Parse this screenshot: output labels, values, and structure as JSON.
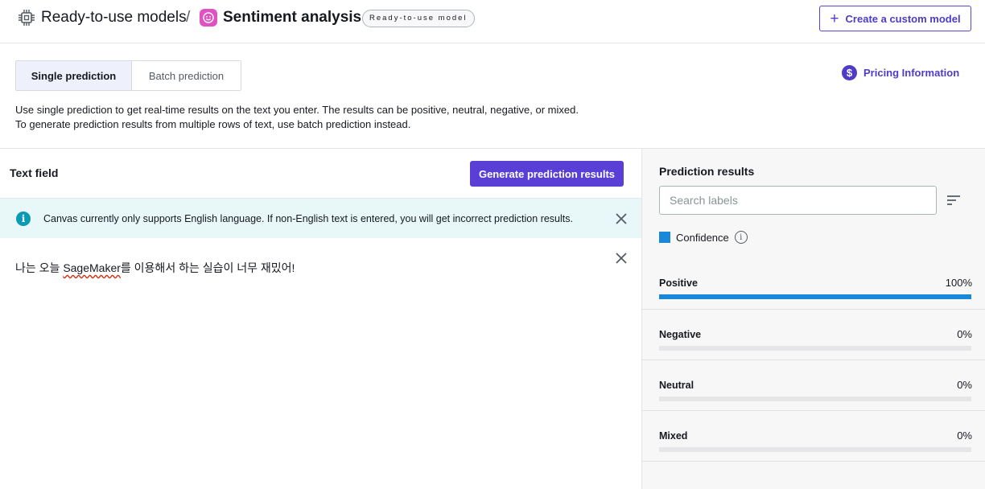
{
  "header": {
    "breadcrumb_root": "Ready-to-use models",
    "breadcrumb_separator": "/",
    "title": "Sentiment analysis",
    "badge": "Ready-to-use model",
    "create_button": "Create a custom model",
    "icons": {
      "models": "chip-icon",
      "sentiment": "smile-icon",
      "add": "plus-icon"
    }
  },
  "tabs": [
    {
      "label": "Single prediction",
      "active": true
    },
    {
      "label": "Batch prediction",
      "active": false
    }
  ],
  "pricing_link": "Pricing Information",
  "description": {
    "line1": "Use single prediction to get real-time results on the text you enter. The results can be positive, neutral, negative, or mixed.",
    "line2": "To generate prediction results from multiple rows of text, use batch prediction instead."
  },
  "text_field": {
    "label": "Text field",
    "generate_button": "Generate prediction results",
    "banner": "Canvas currently only supports English language. If non-English text is entered, you will get incorrect prediction results.",
    "input_pre": "나는 오늘 ",
    "input_misspelled": "SageMaker",
    "input_post": "를 이용해서 하는 실습이 너무 재밌어!"
  },
  "prediction_results": {
    "title": "Prediction results",
    "search_placeholder": "Search labels",
    "legend_label": "Confidence",
    "accent_color": "#1a88d8",
    "results": [
      {
        "label": "Positive",
        "value_text": "100%",
        "value": 1.0
      },
      {
        "label": "Negative",
        "value_text": "0%",
        "value": 0.0
      },
      {
        "label": "Neutral",
        "value_text": "0%",
        "value": 0.0
      },
      {
        "label": "Mixed",
        "value_text": "0%",
        "value": 0.0
      }
    ]
  }
}
